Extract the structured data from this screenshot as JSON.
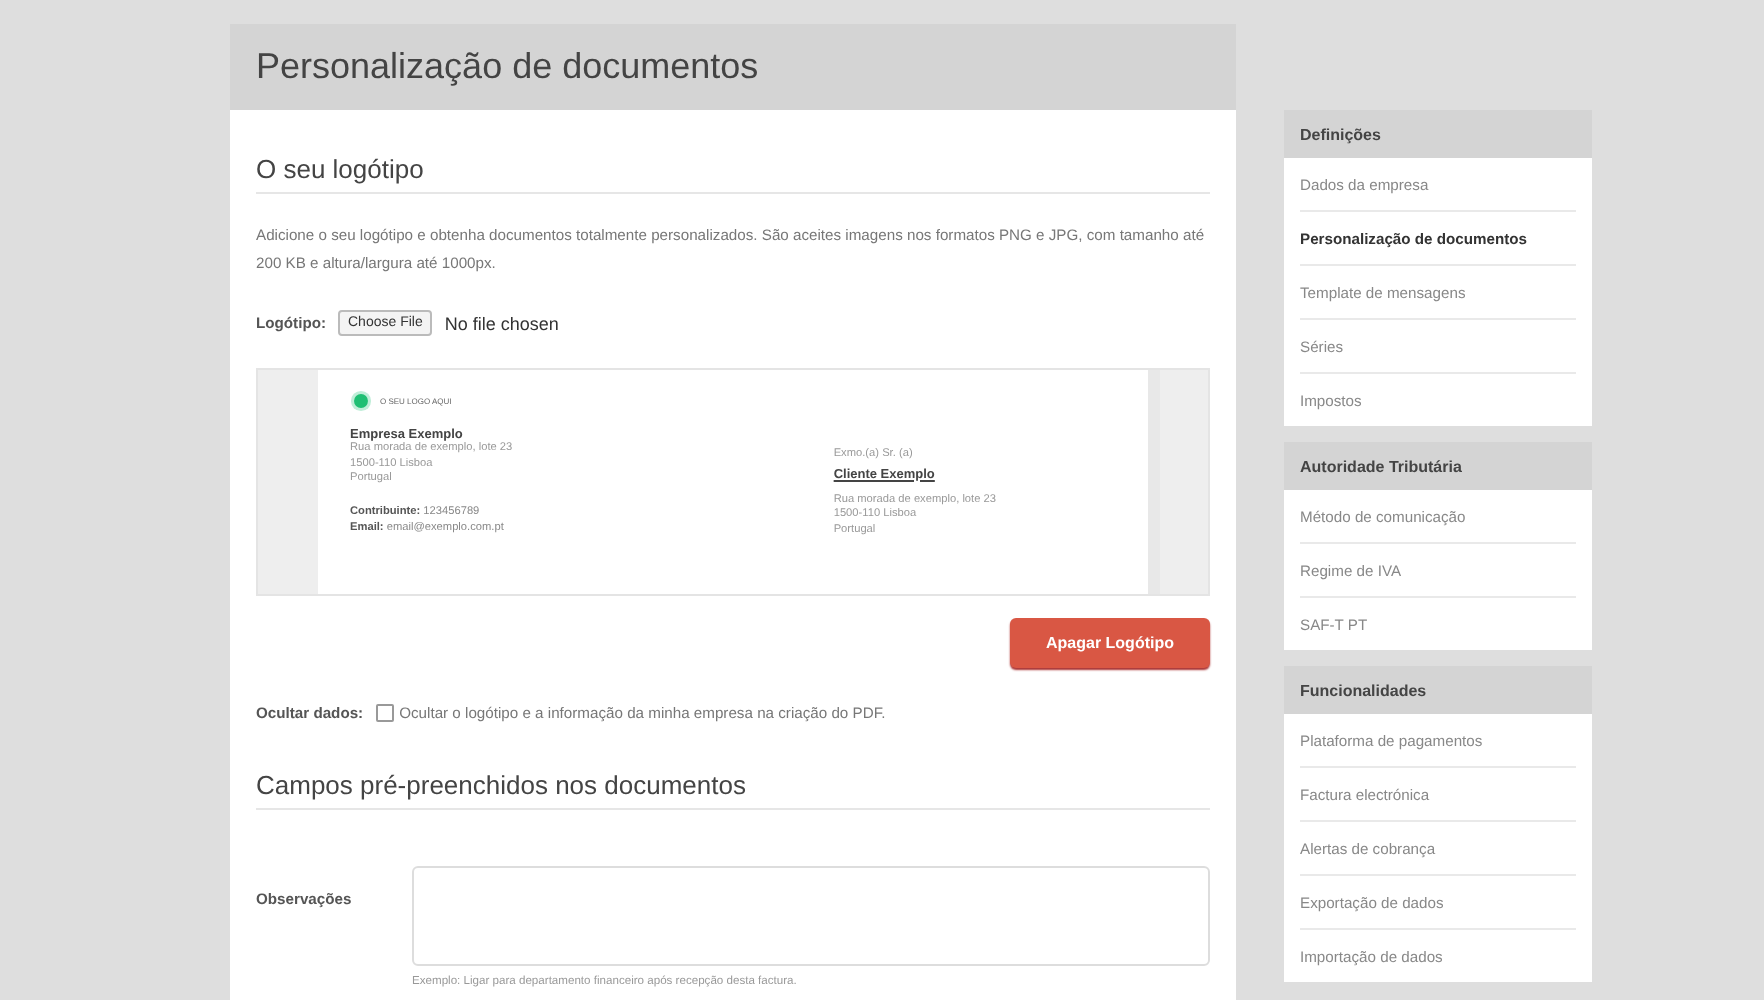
{
  "page": {
    "title": "Personalização de documentos"
  },
  "logo_section": {
    "heading": "O seu logótipo",
    "description": "Adicione o seu logótipo e obtenha documentos totalmente personalizados. São aceites imagens nos formatos PNG e JPG, com tamanho até 200 KB e altura/largura até 1000px.",
    "file_field": {
      "label": "Logótipo:",
      "button": "Choose File",
      "status": "No file chosen"
    },
    "preview": {
      "logo_text": "O SEU LOGO AQUI",
      "company": {
        "name": "Empresa Exemplo",
        "address": [
          "Rua morada de exemplo, lote 23",
          "1500-110 Lisboa",
          "Portugal"
        ],
        "tax_id": "**Contribuinte:** 123456789",
        "email": "**Email:** email@exemplo.com.pt"
      },
      "client": {
        "salutation": "Exmo.(a) Sr. (a)",
        "name": "Cliente Exemplo",
        "address": [
          "Rua morada de exemplo, lote 23",
          "1500-110 Lisboa",
          "Portugal"
        ]
      }
    },
    "delete_button": "Apagar Logótipo",
    "hide_data": {
      "label": "Ocultar dados:",
      "checkbox_label": "Ocultar o logótipo e a informação da minha empresa na criação do PDF.",
      "checked": false
    }
  },
  "prefill_section": {
    "heading": "Campos pré-preenchidos nos documentos",
    "fields": [
      {
        "label": "Observações",
        "hint": "Exemplo: Ligar para departamento financeiro após recepção desta factura."
      }
    ]
  },
  "sidebar": [
    {
      "title": "Definições",
      "items": [
        {
          "label": "Dados da empresa",
          "selected": false
        },
        {
          "label": "Personalização de documentos",
          "selected": true
        },
        {
          "label": "Template de mensagens",
          "selected": false
        },
        {
          "label": "Séries",
          "selected": false
        },
        {
          "label": "Impostos",
          "selected": false
        }
      ]
    },
    {
      "title": "Autoridade Tributária",
      "items": [
        {
          "label": "Método de comunicação",
          "selected": false
        },
        {
          "label": "Regime de IVA",
          "selected": false
        },
        {
          "label": "SAF-T PT",
          "selected": false
        }
      ]
    },
    {
      "title": "Funcionalidades",
      "items": [
        {
          "label": "Plataforma de pagamentos",
          "selected": false
        },
        {
          "label": "Factura electrónica",
          "selected": false
        },
        {
          "label": "Alertas de cobrança",
          "selected": false
        },
        {
          "label": "Exportação de dados",
          "selected": false
        },
        {
          "label": "Importação de dados",
          "selected": false
        }
      ]
    }
  ]
}
